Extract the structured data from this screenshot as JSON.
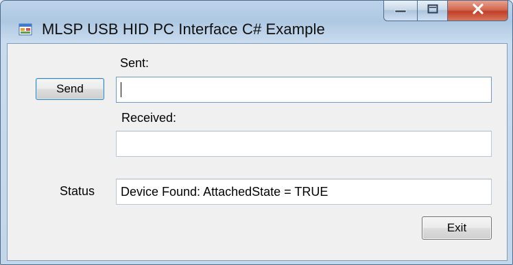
{
  "window": {
    "title": "MLSP USB HID PC Interface C# Example",
    "accent_close": "#c0402a"
  },
  "form": {
    "sent_label": "Sent:",
    "sent_value": "",
    "received_label": "Received:",
    "received_value": "",
    "status_label": "Status",
    "status_value": "Device Found: AttachedState = TRUE",
    "send_button": "Send",
    "exit_button": "Exit"
  },
  "icons": {
    "app": "app-window-icon",
    "minimize": "minimize-icon",
    "maximize": "maximize-icon",
    "close": "close-icon"
  }
}
